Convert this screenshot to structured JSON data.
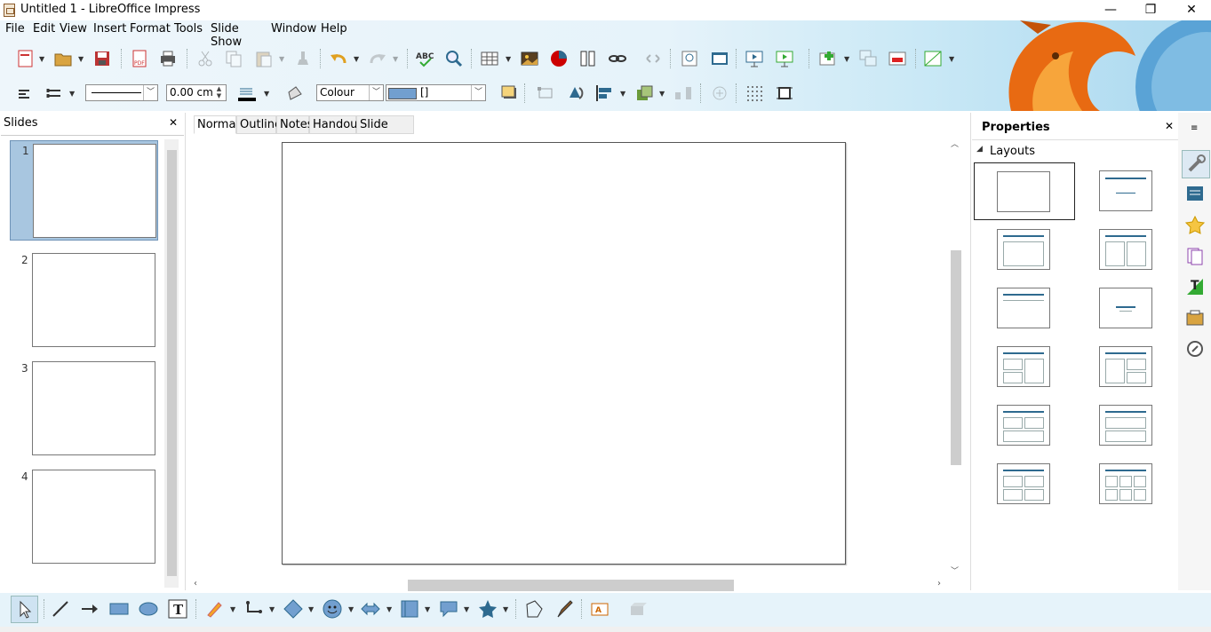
{
  "window": {
    "title": "Untitled 1 - LibreOffice Impress",
    "minimize_glyph": "—",
    "restore_glyph": "❐",
    "close_glyph": "✕"
  },
  "menubar": {
    "items": [
      "File",
      "Edit",
      "View",
      "Insert",
      "Format",
      "Tools",
      "Slide Show",
      "Window",
      "Help"
    ]
  },
  "toolbar2": {
    "line_width": "0.00 cm",
    "area_style": "Colour",
    "area_fill": "[]"
  },
  "slides_pane": {
    "title": "Slides",
    "close_glyph": "✕",
    "slides": [
      {
        "number": "1"
      },
      {
        "number": "2"
      },
      {
        "number": "3"
      },
      {
        "number": "4"
      }
    ]
  },
  "view_tabs": [
    "Normal",
    "Outline",
    "Notes",
    "Handout",
    "Slide Sorter"
  ],
  "properties": {
    "title": "Properties",
    "close_glyph": "✕",
    "section_title": "Layouts",
    "section_glyph": "◢"
  },
  "colors": {
    "selection": "#a8c6e0",
    "accent": "#2e6a8f",
    "toolbar_bg": "#e6f3fa"
  }
}
